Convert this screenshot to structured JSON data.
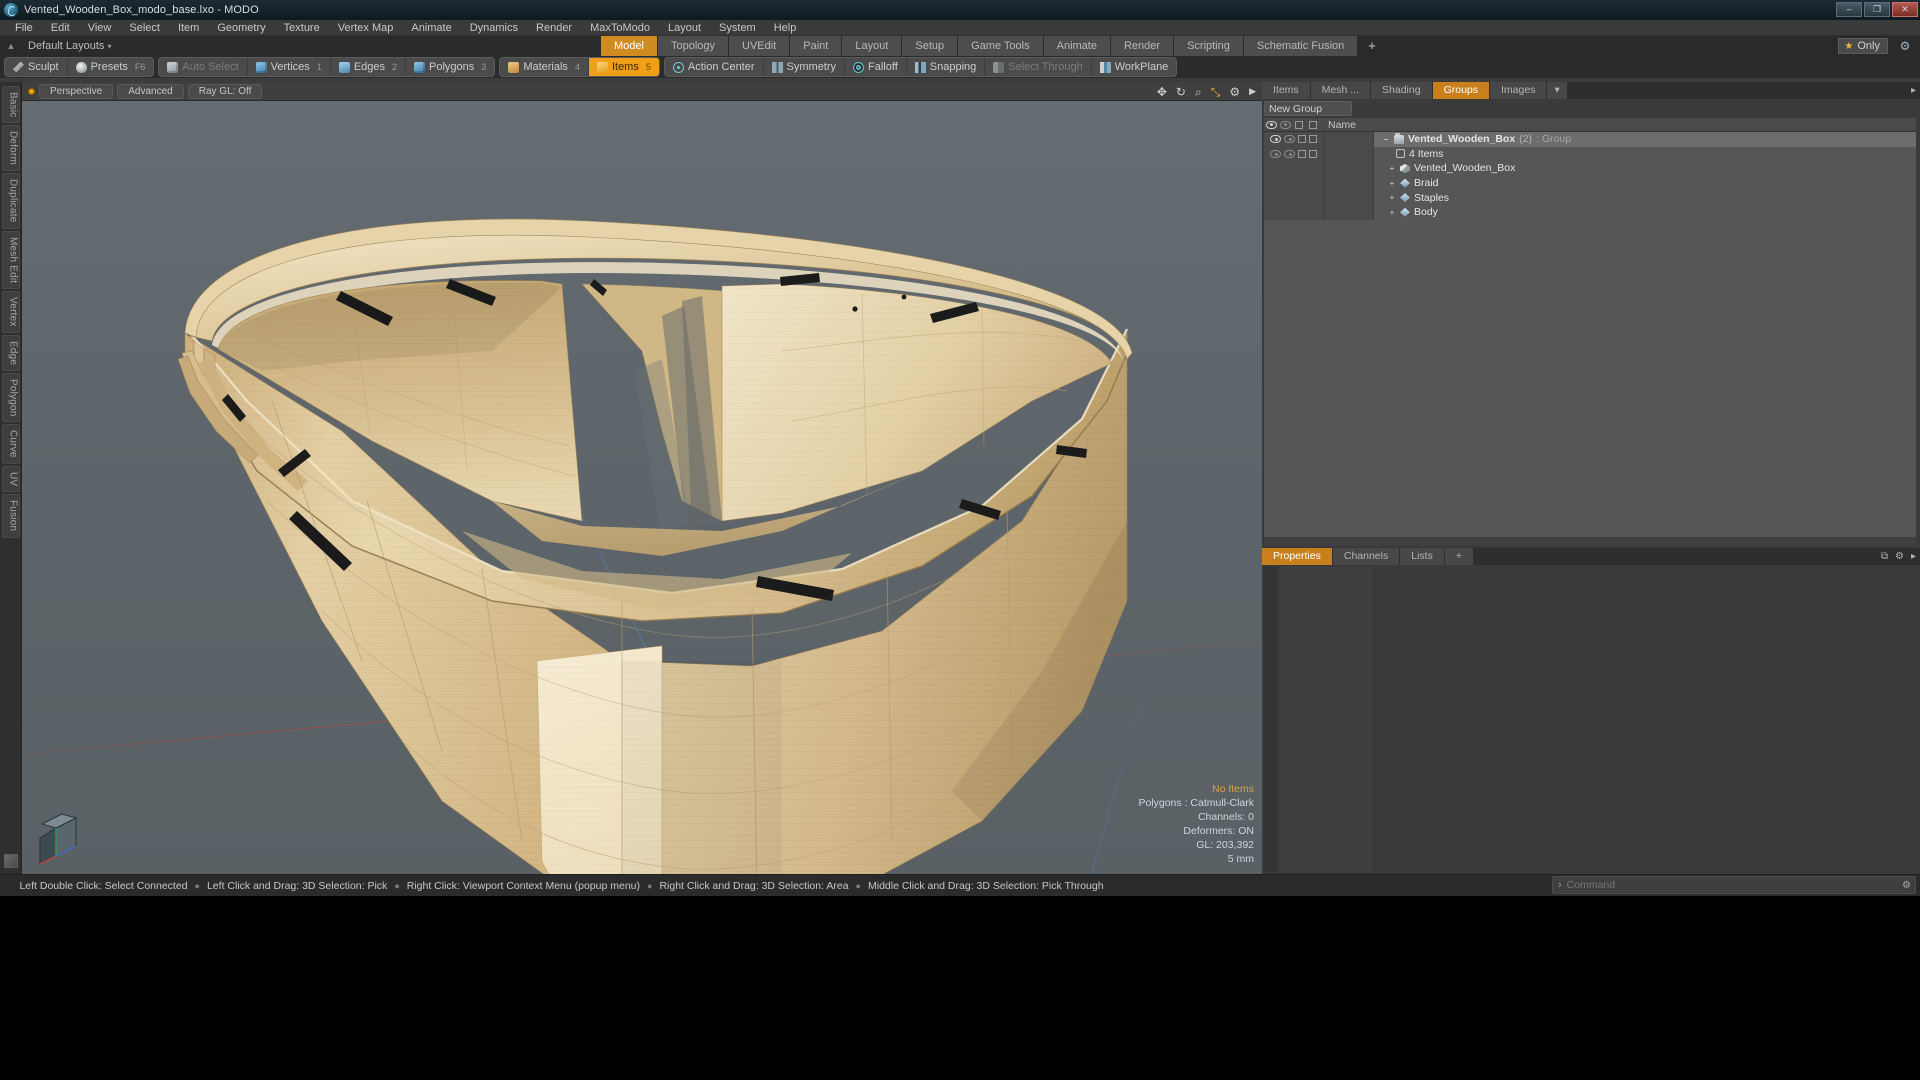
{
  "window": {
    "title": "Vented_Wooden_Box_modo_base.lxo - MODO",
    "app_icon": "modo-app-icon",
    "minimize": "–",
    "maximize": "❐",
    "close": "✕"
  },
  "menubar": {
    "items": [
      {
        "label": "File"
      },
      {
        "label": "Edit"
      },
      {
        "label": "View"
      },
      {
        "label": "Select"
      },
      {
        "label": "Item"
      },
      {
        "label": "Geometry"
      },
      {
        "label": "Texture"
      },
      {
        "label": "Vertex Map"
      },
      {
        "label": "Animate"
      },
      {
        "label": "Dynamics"
      },
      {
        "label": "Render"
      },
      {
        "label": "MaxToModo"
      },
      {
        "label": "Layout"
      },
      {
        "label": "System"
      },
      {
        "label": "Help"
      }
    ]
  },
  "layoutbar": {
    "home_icon": "home-arrow-icon",
    "layout_selector": "Default Layouts",
    "caret": "▾",
    "tabs": [
      {
        "label": "Model",
        "active": false
      },
      {
        "label": "Topology",
        "active": false
      },
      {
        "label": "UVEdit",
        "active": false
      },
      {
        "label": "Paint",
        "active": false
      },
      {
        "label": "Layout",
        "active": false
      },
      {
        "label": "Setup",
        "active": false
      },
      {
        "label": "Game Tools",
        "active": false
      },
      {
        "label": "Animate",
        "active": false
      },
      {
        "label": "Render",
        "active": false
      },
      {
        "label": "Scripting",
        "active": false
      },
      {
        "label": "Schematic Fusion",
        "active": false
      }
    ],
    "add_tab": "+",
    "only_toggle": {
      "star": "★",
      "label": "Only"
    },
    "settings_icon": "gear-icon"
  },
  "toolbar": {
    "group1": [
      {
        "label": "Sculpt",
        "icon": "sculpt-icon",
        "num": "",
        "state": "normal"
      },
      {
        "label": "Presets",
        "icon": "presets-icon",
        "num": "F6",
        "state": "normal"
      }
    ],
    "group2": [
      {
        "label": "Auto Select",
        "icon": "auto-select-icon",
        "num": "",
        "state": "dim"
      },
      {
        "label": "Vertices",
        "icon": "vertices-icon",
        "num": "1",
        "state": "normal"
      },
      {
        "label": "Edges",
        "icon": "edges-icon",
        "num": "2",
        "state": "normal"
      },
      {
        "label": "Polygons",
        "icon": "polygons-icon",
        "num": "3",
        "state": "normal"
      }
    ],
    "group3": [
      {
        "label": "Materials",
        "icon": "materials-icon",
        "num": "4",
        "state": "normal"
      },
      {
        "label": "Items",
        "icon": "items-icon",
        "num": "5",
        "state": "active"
      }
    ],
    "group4": [
      {
        "label": "Action Center",
        "icon": "action-center-icon",
        "num": "",
        "state": "normal"
      },
      {
        "label": "Symmetry",
        "icon": "symmetry-icon",
        "num": "",
        "state": "normal"
      },
      {
        "label": "Falloff",
        "icon": "falloff-icon",
        "num": "",
        "state": "normal"
      },
      {
        "label": "Snapping",
        "icon": "snapping-icon",
        "num": "",
        "state": "normal"
      },
      {
        "label": "Select Through",
        "icon": "select-through-icon",
        "num": "",
        "state": "dim"
      },
      {
        "label": "WorkPlane",
        "icon": "workplane-icon",
        "num": "",
        "state": "normal"
      }
    ]
  },
  "left_tool_tabs": [
    {
      "label": "Basic"
    },
    {
      "label": "Deform"
    },
    {
      "label": "Duplicate"
    },
    {
      "label": "Mesh Edit"
    },
    {
      "label": "Vertex"
    },
    {
      "label": "Edge"
    },
    {
      "label": "Polygon"
    },
    {
      "label": "Curve"
    },
    {
      "label": "UV"
    },
    {
      "label": "Fusion"
    }
  ],
  "viewport": {
    "header": {
      "dot": "viewport-active-dot",
      "buttons": [
        {
          "label": "Perspective"
        },
        {
          "label": "Advanced"
        },
        {
          "label": "Ray GL: Off"
        }
      ],
      "icons": [
        {
          "name": "move-icon",
          "glyph": "✥",
          "color": "default"
        },
        {
          "name": "rotate-icon",
          "glyph": "↻",
          "color": "default"
        },
        {
          "name": "zoom-icon",
          "glyph": "⌕",
          "color": "default"
        },
        {
          "name": "fit-view-icon",
          "glyph": "⤡",
          "color": "yellow"
        },
        {
          "name": "gear-icon",
          "glyph": "⚙",
          "color": "default"
        },
        {
          "name": "expand-arrow-icon",
          "glyph": "▶",
          "color": "default"
        }
      ]
    },
    "gizmo": "axis-orientation-gizmo",
    "info": {
      "no_items": "No Items",
      "polygons": "Polygons : Catmull-Clark",
      "channels": "Channels: 0",
      "deformers": "Deformers: ON",
      "gl": "GL: 203,392",
      "scale": "5 mm"
    },
    "model_name": "vented-wooden-box-3d-model"
  },
  "right_panel": {
    "tabs": [
      {
        "label": "Items",
        "active": false
      },
      {
        "label": "Mesh ...",
        "active": false
      },
      {
        "label": "Shading",
        "active": false
      },
      {
        "label": "Groups",
        "active": true
      },
      {
        "label": "Images",
        "active": false
      }
    ],
    "tab_extra_caret": "▾",
    "tab_extra_arrow": "▸",
    "new_group_button": "New Group",
    "tree_header": {
      "name_column": "Name"
    },
    "tree": [
      {
        "label": "Vented_Wooden_Box",
        "suffix": "(2)",
        "type": " : Group",
        "icon": "group-icon",
        "indent": 0,
        "bold": true,
        "selected": true,
        "twisty": "–"
      },
      {
        "label": "4 Items",
        "suffix": "",
        "type": "",
        "icon": "items-count-icon",
        "indent": 1,
        "bold": false,
        "selected": false,
        "twisty": ""
      },
      {
        "label": "Vented_Wooden_Box",
        "suffix": "",
        "type": "",
        "icon": "mesh-icon",
        "indent": 1,
        "bold": false,
        "selected": false,
        "twisty": "+"
      },
      {
        "label": "Braid",
        "suffix": "",
        "type": "",
        "icon": "sub-mesh-icon",
        "indent": 1,
        "bold": false,
        "selected": false,
        "twisty": "+"
      },
      {
        "label": "Staples",
        "suffix": "",
        "type": "",
        "icon": "sub-mesh-icon",
        "indent": 1,
        "bold": false,
        "selected": false,
        "twisty": "+"
      },
      {
        "label": "Body",
        "suffix": "",
        "type": "",
        "icon": "sub-mesh-icon",
        "indent": 1,
        "bold": false,
        "selected": false,
        "twisty": "+"
      }
    ]
  },
  "properties_panel": {
    "tabs": [
      {
        "label": "Properties",
        "active": true
      },
      {
        "label": "Channels",
        "active": false
      },
      {
        "label": "Lists",
        "active": false
      }
    ],
    "add_tab": "+",
    "expand_icon": "expand-icon",
    "settings_icon": "gear-icon"
  },
  "statusbar": {
    "hints": [
      "Left Double Click: Select Connected",
      "Left Click and Drag: 3D Selection: Pick",
      "Right Click: Viewport Context Menu (popup menu)",
      "Right Click and Drag: 3D Selection: Area",
      "Middle Click and Drag: 3D Selection: Pick Through"
    ],
    "separator": "●",
    "command_prompt": "›",
    "command_placeholder": "Command",
    "command_value": "",
    "command_gear": "⚙"
  },
  "colors": {
    "accent_orange": "#f0a018",
    "tab_active": "#c97f1c",
    "panel_bg": "#3a3a3a",
    "tree_bg": "#565656",
    "viewport_bg": "#5e666b",
    "wood_light": "#e8d5ab",
    "wood_mid": "#d9c190",
    "wood_dark": "#b99b66",
    "axis_red": "#be4646",
    "axis_blue": "#5078c8",
    "info_amber": "#d6a34a"
  }
}
